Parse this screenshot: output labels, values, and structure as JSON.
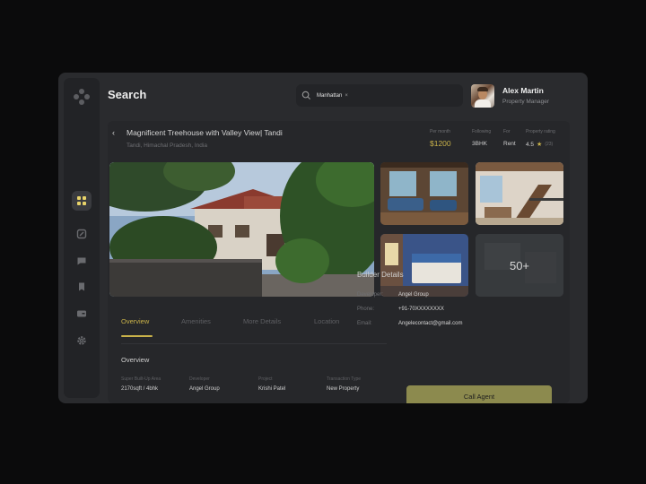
{
  "page": {
    "title": "Search"
  },
  "search": {
    "chip_label": "Manhattan",
    "chip_remove": "×"
  },
  "user": {
    "name": "Alex Martin",
    "role": "Property Manager"
  },
  "sidebar": {
    "items": [
      {
        "name": "dashboard",
        "icon": "grid-icon",
        "active": true
      },
      {
        "name": "properties",
        "icon": "tag-icon",
        "active": false
      },
      {
        "name": "messages",
        "icon": "chat-icon",
        "active": false
      },
      {
        "name": "saved",
        "icon": "bookmark-icon",
        "active": false
      },
      {
        "name": "cards",
        "icon": "card-icon",
        "active": false
      },
      {
        "name": "settings",
        "icon": "gear-icon",
        "active": false
      }
    ]
  },
  "property": {
    "title": "Magnificent Treehouse with Valley View| Tandi",
    "location": "Tandi, Himachal Pradesh, India",
    "stats": [
      {
        "label": "Per month",
        "value": "$1200"
      },
      {
        "label": "Following",
        "value": "3BHK"
      },
      {
        "label": "For",
        "value": "Rent"
      },
      {
        "label": "Property rating",
        "value": "4.5",
        "reviews": "(23)"
      }
    ],
    "more_photos": "50+"
  },
  "tabs": [
    "Overview",
    "Amenities",
    "More Details",
    "Location"
  ],
  "overview": {
    "heading": "Overview",
    "fields": [
      {
        "label": "Super Built-Up Area",
        "value": "2170sqft / 4bhk"
      },
      {
        "label": "Developer",
        "value": "Angel Group"
      },
      {
        "label": "Project",
        "value": "Krishi Patel"
      },
      {
        "label": "Transaction Type",
        "value": "New Property"
      }
    ]
  },
  "builder": {
    "title": "Builder Details",
    "rows": [
      {
        "label": "Developer:",
        "value": "Angel Group"
      },
      {
        "label": "Phone:",
        "value": "+91-70XXXXXXXX"
      },
      {
        "label": "Email:",
        "value": "Angelecontact@gmail.com"
      }
    ],
    "cta": "Call Agent"
  },
  "colors": {
    "accent": "#c9b24a",
    "background": "#0b0b0c",
    "panel": "#2a2b2e"
  }
}
